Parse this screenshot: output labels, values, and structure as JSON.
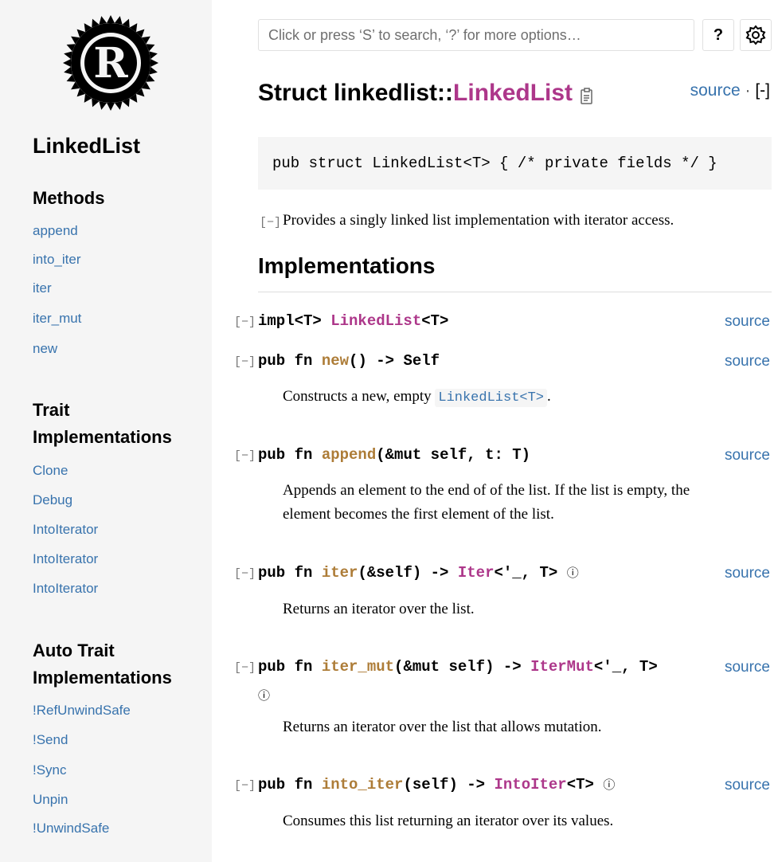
{
  "sidebar": {
    "title": "LinkedList",
    "methods_heading": "Methods",
    "methods": [
      "append",
      "into_iter",
      "iter",
      "iter_mut",
      "new"
    ],
    "trait_heading_line1": "Trait",
    "trait_heading_line2": "Implementations",
    "traits": [
      "Clone",
      "Debug",
      "IntoIterator",
      "IntoIterator",
      "IntoIterator"
    ],
    "auto_heading_line1": "Auto Trait",
    "auto_heading_line2": "Implementations",
    "auto_traits": [
      "!RefUnwindSafe",
      "!Send",
      "!Sync",
      "Unpin",
      "!UnwindSafe"
    ]
  },
  "search": {
    "placeholder": "Click or press ‘S’ to search, ‘?’ for more options…"
  },
  "help_label": "?",
  "title": {
    "prefix": "Struct linkedlist::",
    "name": "LinkedList"
  },
  "source_link": "source",
  "source_sep": " · ",
  "collapse_all": "[-]",
  "declaration": "pub struct LinkedList<T> { /* private fields */ }",
  "summary": "Provides a singly linked list implementation with iterator access.",
  "toggle_glyph": "[−]",
  "implementations_heading": "Implementations",
  "impl_block": {
    "prefix": "impl<T> ",
    "type": "LinkedList",
    "suffix": "<T>"
  },
  "methods": [
    {
      "prefix": "pub fn ",
      "name": "new",
      "signature": "() -> Self",
      "doc_pre": "Constructs a new, empty ",
      "doc_code": "LinkedList<T>",
      "doc_post": "."
    },
    {
      "prefix": "pub fn ",
      "name": "append",
      "signature": "(&mut self, t: T)",
      "doc_line1": "Appends an element to the end of of the list. If the list is empty, the",
      "doc_line2": "element becomes the first element of the list."
    },
    {
      "prefix": "pub fn ",
      "name": "iter",
      "signature": "(&self) -> ",
      "ret_type": "Iter",
      "ret_suffix": "<'_, T>",
      "info": "ⓘ",
      "doc": "Returns an iterator over the list."
    },
    {
      "prefix": "pub fn ",
      "name": "iter_mut",
      "signature": "(&mut self) -> ",
      "ret_type": "IterMut",
      "ret_suffix": "<'_, T>",
      "info": "ⓘ",
      "doc": "Returns an iterator over the list that allows mutation."
    },
    {
      "prefix": "pub fn ",
      "name": "into_iter",
      "signature": "(self) -> ",
      "ret_type": "IntoIter",
      "ret_suffix": "<T>",
      "info": "ⓘ",
      "doc": "Consumes this list returning an iterator over its values."
    }
  ]
}
